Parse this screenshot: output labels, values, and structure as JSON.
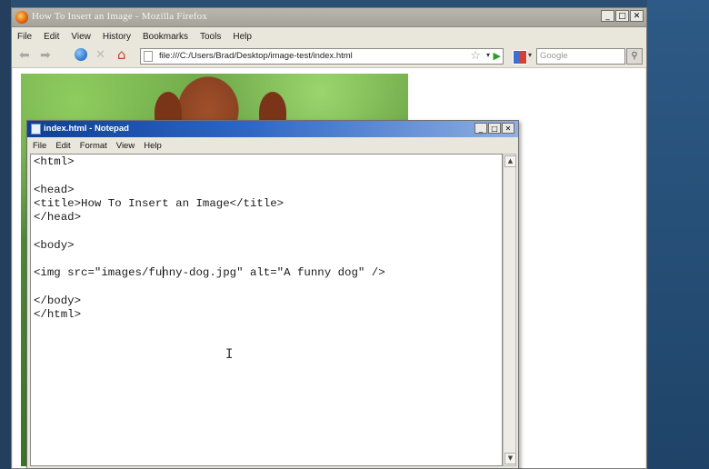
{
  "firefox": {
    "title": "How To Insert an Image - Mozilla Firefox",
    "menu": [
      "File",
      "Edit",
      "View",
      "History",
      "Bookmarks",
      "Tools",
      "Help"
    ],
    "url": "file:///C:/Users/Brad/Desktop/image-test/index.html",
    "search_placeholder": "Google",
    "window_buttons": [
      "_",
      "□",
      "✕"
    ],
    "nav_icons": {
      "back": "back-arrow-icon",
      "forward": "forward-arrow-icon",
      "reload": "reload-icon",
      "stop": "stop-icon",
      "home": "home-icon"
    },
    "page_image_alt": "A funny dog"
  },
  "notepad": {
    "title": "index.html - Notepad",
    "menu": [
      "File",
      "Edit",
      "Format",
      "View",
      "Help"
    ],
    "window_buttons": [
      "_",
      "□",
      "✕"
    ],
    "lines": [
      "<html>",
      "",
      "<head>",
      "<title>How To Insert an Image</title>",
      "</head>",
      "",
      "<body>",
      "",
      "<img src=\"images/funny-dog.jpg\" alt=\"A funny dog\" />",
      "",
      "</body>",
      "</html>"
    ]
  },
  "icons": {
    "scroll_up": "▲",
    "scroll_down": "▼",
    "star": "☆",
    "dropdown": "▾",
    "go": "▶",
    "search_button": "🔍",
    "back": "⬅",
    "forward": "➡",
    "stop": "✕",
    "home": "⌂",
    "mouse_cursor": "I"
  },
  "colors": {
    "notepad_title_start": "#0f3f96",
    "notepad_title_end": "#8fb0e2",
    "desktop": "#2a4f74"
  }
}
